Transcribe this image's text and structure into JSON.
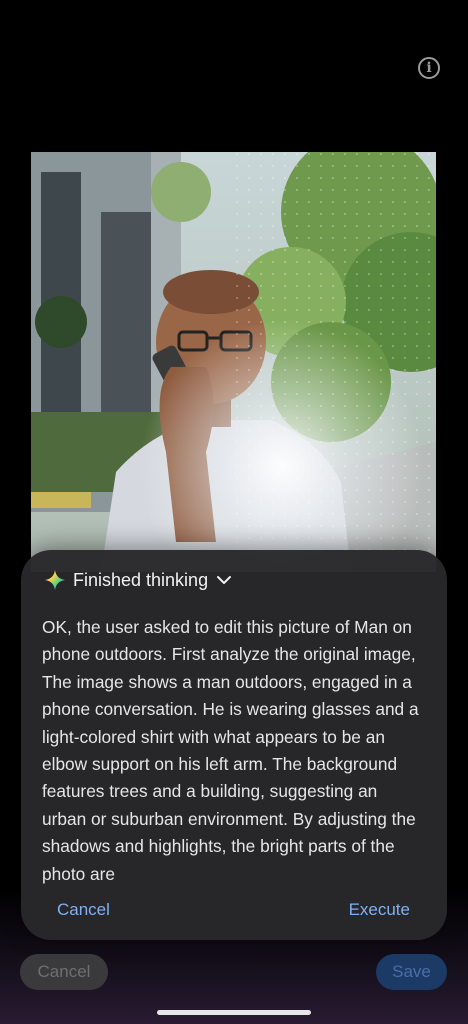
{
  "info_icon": "info-icon",
  "sheet": {
    "header_title": "Finished thinking",
    "header_icon": "sparkle-icon",
    "chevron_icon": "chevron-down-icon",
    "thinking_text": "OK, the user asked to edit this picture of Man on phone outdoors. First analyze the original image, The image shows a man outdoors, engaged in a phone conversation. He is wearing glasses and a light-colored shirt with what appears to be an elbow support on his left arm. The background features trees and a building, suggesting an urban or suburban environment. By adjusting the shadows and highlights, the bright parts of the photo are",
    "cancel_label": "Cancel",
    "execute_label": "Execute"
  },
  "bottom_bar": {
    "cancel_label": "Cancel",
    "save_label": "Save"
  },
  "colors": {
    "background": "#000000",
    "sheet_bg": "#28282a",
    "accent_link": "#7fb0f5",
    "save_button_bg": "#1b3a66"
  }
}
